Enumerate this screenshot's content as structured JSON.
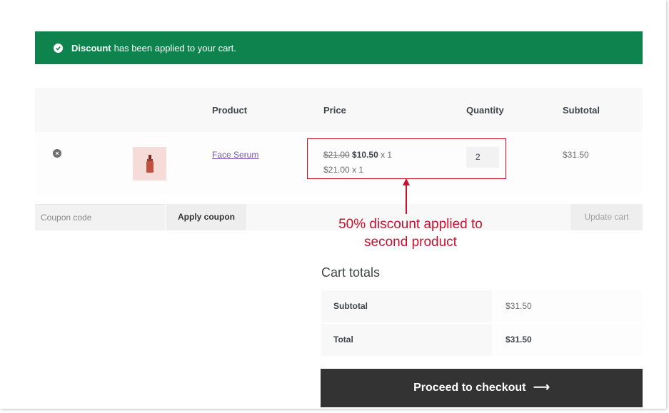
{
  "notice": {
    "bold": "Discount",
    "text": "has been applied to your cart.",
    "color": "#0f834d"
  },
  "cart_table": {
    "headers": {
      "product": "Product",
      "price": "Price",
      "quantity": "Quantity",
      "subtotal": "Subtotal"
    },
    "rows": [
      {
        "product": "Face Serum",
        "price_original": "$21.00",
        "price_discounted": "$10.50",
        "price_discounted_qty": "x 1",
        "price_second": "$21.00 x 1",
        "quantity": "2",
        "subtotal": "$31.50"
      }
    ]
  },
  "actions": {
    "coupon_placeholder": "Coupon code",
    "apply_label": "Apply coupon",
    "update_label": "Update cart"
  },
  "annotation": {
    "line1": "50% discount applied to",
    "line2": "second product",
    "color": "#c8102e"
  },
  "totals": {
    "title": "Cart totals",
    "subtotal_label": "Subtotal",
    "subtotal_value": "$31.50",
    "total_label": "Total",
    "total_value": "$31.50"
  },
  "checkout": {
    "label": "Proceed to checkout",
    "arrow": "⟶"
  },
  "icons": {
    "notice": "check-circle-icon",
    "remove": "remove-x-icon",
    "product": "serum-bottle-icon"
  }
}
